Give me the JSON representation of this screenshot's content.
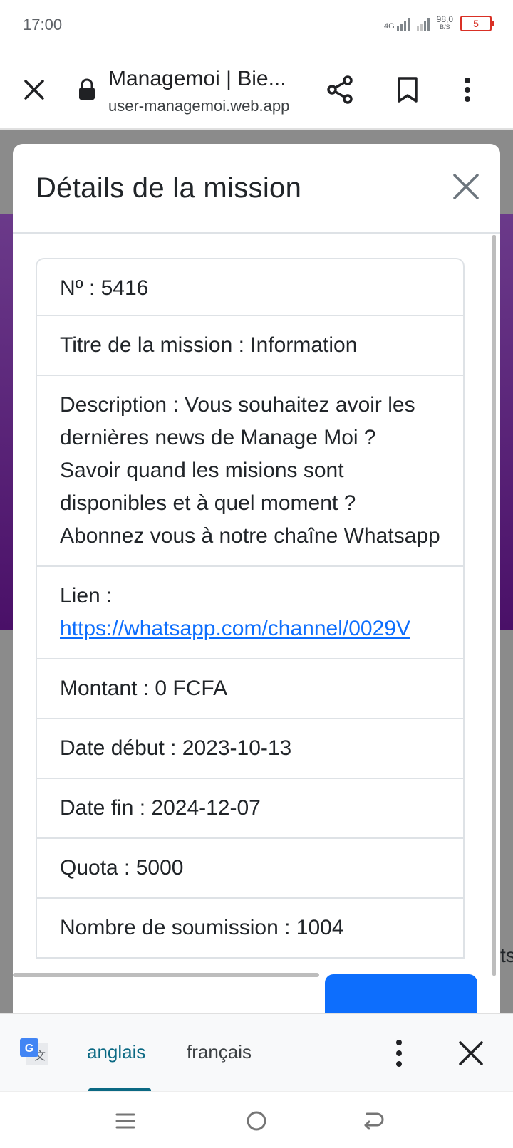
{
  "status_bar": {
    "time": "17:00",
    "network_type": "4G",
    "speed_value": "98,0",
    "speed_unit": "B/S",
    "battery_level": "5"
  },
  "browser": {
    "page_title": "Managemoi | Bie...",
    "url": "user-managemoi.web.app",
    "icons": [
      "close-icon",
      "lock-icon",
      "share-icon",
      "bookmark-icon",
      "more-vert-icon"
    ]
  },
  "modal": {
    "title": "Détails de la mission",
    "rows": [
      "Nº : 5416",
      "Titre de la mission : Information",
      "Description : Vous souhaitez avoir les dernières news de Manage Moi ? Savoir quand les misions sont disponibles et à quel moment ? Abonnez vous à notre chaîne Whatsapp",
      "Lien :",
      "Montant : 0 FCFA",
      "Date début : 2023-10-13",
      "Date fin : 2024-12-07",
      "Quota : 5000",
      "Nombre de soumission : 1004"
    ],
    "link_url": "https://whatsapp.com/channel/0029V",
    "side_text": "ts"
  },
  "translate_bar": {
    "active_language": "anglais",
    "inactive_language": "français",
    "accent_color": "#0b6983"
  },
  "colors": {
    "primary_button": "#0d6efd",
    "link": "#0d6efd",
    "page_purple": "#5a1f7a",
    "battery_low": "#d93025"
  }
}
